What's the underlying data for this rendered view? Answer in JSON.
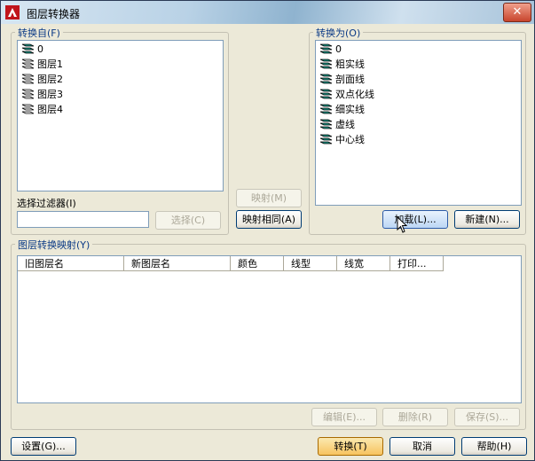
{
  "window": {
    "title": "图层转换器",
    "close_glyph": "✕"
  },
  "from_panel": {
    "legend": "转换自(F)",
    "items": [
      "0",
      "图层1",
      "图层2",
      "图层3",
      "图层4"
    ],
    "filter_label": "选择过滤器(I)",
    "filter_value": "",
    "select_button": "选择(C)"
  },
  "middle": {
    "map_button": "映射(M)",
    "map_same_button": "映射相同(A)"
  },
  "to_panel": {
    "legend": "转换为(O)",
    "items": [
      "0",
      "粗实线",
      "剖面线",
      "双点化线",
      "细实线",
      "虚线",
      "中心线"
    ],
    "load_button": "加载(L)...",
    "new_button": "新建(N)..."
  },
  "mapping": {
    "legend": "图层转换映射(Y)",
    "columns": [
      "旧图层名",
      "新图层名",
      "颜色",
      "线型",
      "线宽",
      "打印..."
    ],
    "edit_button": "编辑(E)...",
    "delete_button": "删除(R)",
    "save_button": "保存(S)..."
  },
  "footer": {
    "settings_button": "设置(G)...",
    "translate_button": "转换(T)",
    "cancel_button": "取消",
    "help_button": "帮助(H)"
  }
}
